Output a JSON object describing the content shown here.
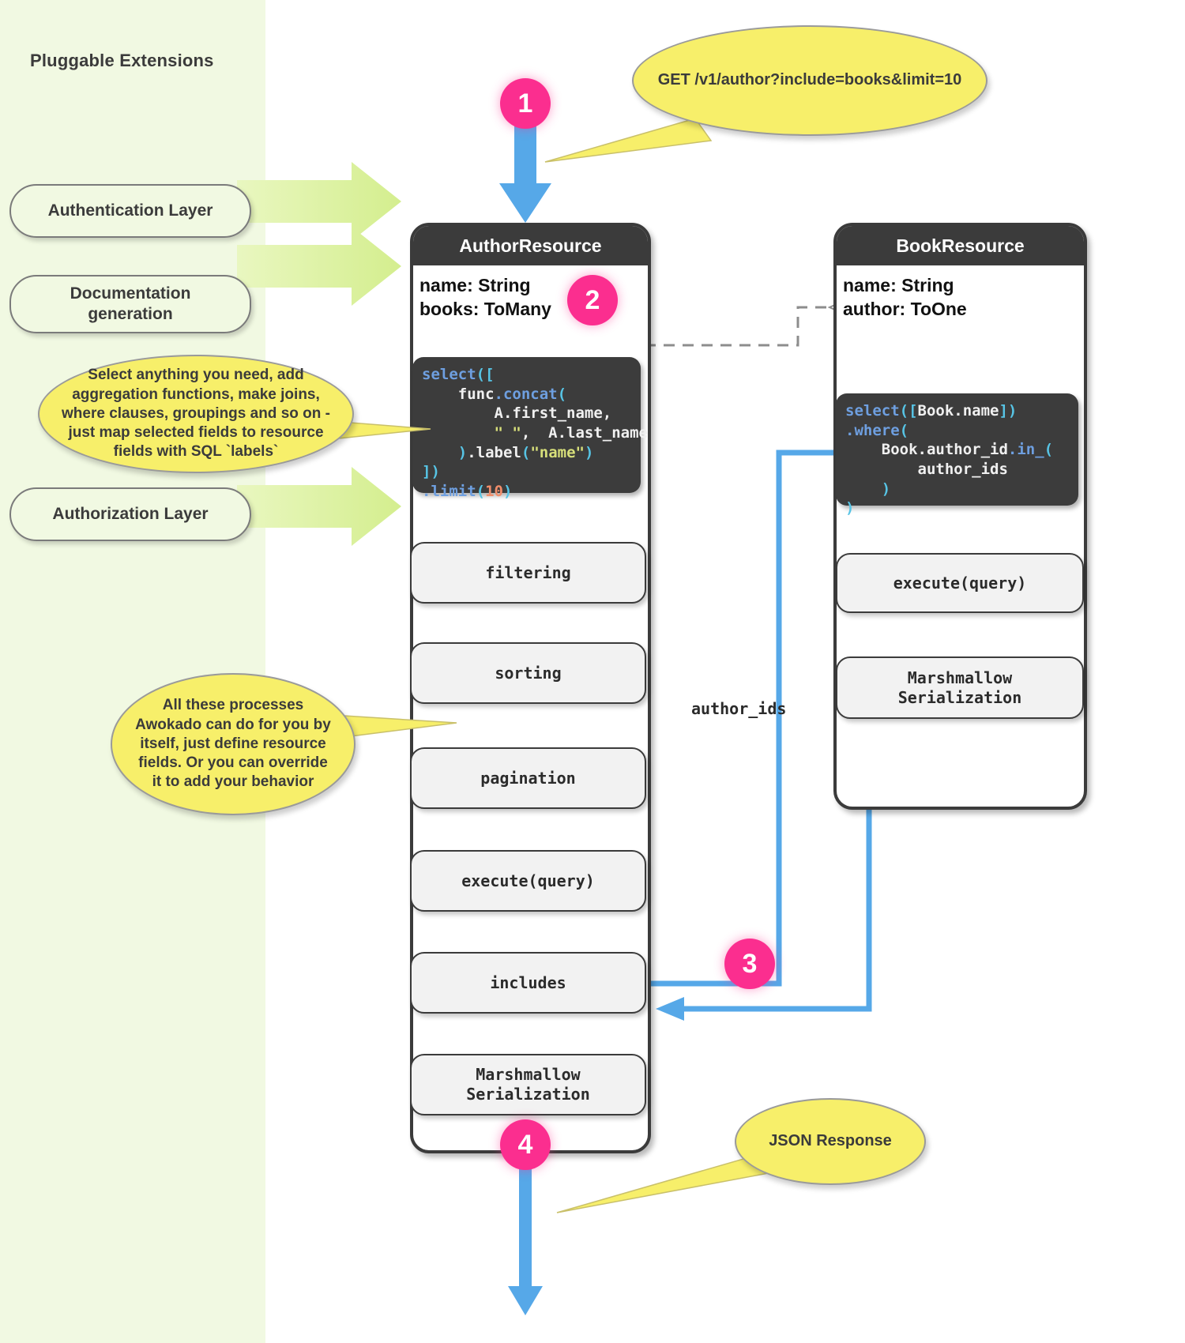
{
  "panel": {
    "title": "Pluggable Extensions",
    "items": [
      {
        "label": "Authentication Layer"
      },
      {
        "label": "Documentation\ngeneration"
      },
      {
        "label": "Authorization Layer"
      }
    ]
  },
  "markers": [
    {
      "n": "1"
    },
    {
      "n": "2"
    },
    {
      "n": "3"
    },
    {
      "n": "4"
    }
  ],
  "bubbles": {
    "request": "GET /v1/author?include=books&limit=10",
    "select_note": "Select anything you need, add aggregation functions, make joins, where clauses, groupings and so on - just map selected fields to resource fields with SQL `labels`",
    "process_note": "All these processes Awokado can do for you by itself, just define resource fields. Or you can override it to add your behavior",
    "response": "JSON Response"
  },
  "author_resource": {
    "title": "AuthorResource",
    "fields": [
      "name: String",
      "books: ToMany"
    ],
    "code_lines": [
      [
        {
          "t": "select",
          "c": "k-blue"
        },
        {
          "t": "([",
          "c": "k-cyan"
        }
      ],
      [
        {
          "t": "    func",
          "c": "k-white"
        },
        {
          "t": ".concat",
          "c": "k-blue"
        },
        {
          "t": "(",
          "c": "k-cyan"
        }
      ],
      [
        {
          "t": "        A.first_name,",
          "c": "k-white"
        }
      ],
      [
        {
          "t": "        ",
          "c": "k-white"
        },
        {
          "t": "\" \"",
          "c": "k-str"
        },
        {
          "t": ",  A.last_name",
          "c": "k-white"
        }
      ],
      [
        {
          "t": "    ",
          "c": "k-white"
        },
        {
          "t": ")",
          "c": "k-cyan"
        },
        {
          "t": ".label",
          "c": "k-white"
        },
        {
          "t": "(",
          "c": "k-cyan"
        },
        {
          "t": "\"name\"",
          "c": "k-str"
        },
        {
          "t": ")",
          "c": "k-cyan"
        }
      ],
      [
        {
          "t": "])",
          "c": "k-cyan"
        }
      ],
      [
        {
          "t": ".limit",
          "c": "k-blue"
        },
        {
          "t": "(",
          "c": "k-cyan"
        },
        {
          "t": "10",
          "c": "k-num"
        },
        {
          "t": ")",
          "c": "k-cyan"
        }
      ]
    ],
    "steps": [
      "filtering",
      "sorting",
      "pagination",
      "execute(query)",
      "includes",
      "Marshmallow\nSerialization"
    ]
  },
  "book_resource": {
    "title": "BookResource",
    "fields": [
      "name: String",
      "author: ToOne"
    ],
    "code_lines": [
      [
        {
          "t": "select",
          "c": "k-blue"
        },
        {
          "t": "([",
          "c": "k-cyan"
        },
        {
          "t": "Book.name",
          "c": "k-white"
        },
        {
          "t": "])",
          "c": "k-cyan"
        }
      ],
      [
        {
          "t": ".where",
          "c": "k-blue"
        },
        {
          "t": "(",
          "c": "k-cyan"
        }
      ],
      [
        {
          "t": "    Book.author_id",
          "c": "k-white"
        },
        {
          "t": ".in_",
          "c": "k-blue"
        },
        {
          "t": "(",
          "c": "k-cyan"
        }
      ],
      [
        {
          "t": "        author_ids",
          "c": "k-white"
        }
      ],
      [
        {
          "t": "    )",
          "c": "k-cyan"
        }
      ],
      [
        {
          "t": ")",
          "c": "k-cyan"
        }
      ]
    ],
    "steps": [
      "execute(query)",
      "Marshmallow\nSerialization"
    ]
  },
  "edge_labels": {
    "author_ids": "author_ids"
  },
  "colors": {
    "accent_pink": "#fb2e8f",
    "arrow_blue": "#56a8e8",
    "bubble_yellow": "#f7ef6a",
    "panel_green": "#f1f9e2",
    "green_arrow": "#dff2a8",
    "dark": "#3b3b3b"
  }
}
